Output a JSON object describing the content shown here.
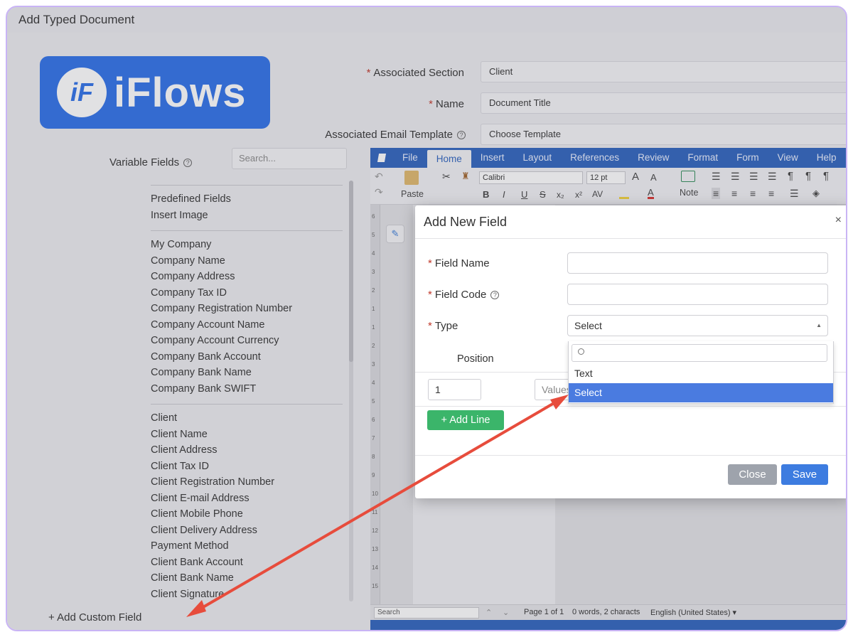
{
  "window": {
    "title": "Add Typed Document"
  },
  "logo": {
    "mark": "iF",
    "text": "iFlows"
  },
  "form": {
    "associated_section_label": "Associated Section",
    "associated_section_value": "Client",
    "name_label": "Name",
    "name_value": "Document Title",
    "email_template_label": "Associated Email Template",
    "email_template_value": "Choose Template",
    "required_mark": "*",
    "help_icon": "?"
  },
  "variable_fields": {
    "label": "Variable Fields",
    "search_placeholder": "Search...",
    "groups": [
      [
        "Predefined Fields",
        "Insert Image"
      ],
      [
        "My Company",
        "Company Name",
        "Company Address",
        "Company Tax ID",
        "Company Registration Number",
        "Company Account Name",
        "Company Account Currency",
        "Company Bank Account",
        "Company Bank Name",
        "Company Bank SWIFT"
      ],
      [
        "Client",
        "Client Name",
        "Client Address",
        "Client Tax ID",
        "Client Registration Number",
        "Client E-mail Address",
        "Client Mobile Phone",
        "Client Delivery Address",
        "Payment Method",
        "Client Bank Account",
        "Client Bank Name",
        "Client Signature"
      ]
    ],
    "add_custom": "+ Add Custom Field"
  },
  "editor": {
    "menu": [
      "File",
      "Home",
      "Insert",
      "Layout",
      "References",
      "Review",
      "Format",
      "Form",
      "View",
      "Help"
    ],
    "active_menu": "Home",
    "paste": "Paste",
    "font": "Calibri",
    "size": "12 pt",
    "note": "Note",
    "format_buttons": [
      "B",
      "I",
      "U",
      "S",
      "x₂",
      "x²"
    ],
    "ruler": [
      "6",
      "5",
      "4",
      "3",
      "2",
      "1",
      "1",
      "2",
      "3",
      "4",
      "5",
      "6",
      "7",
      "8",
      "9",
      "10",
      "11",
      "12",
      "13",
      "14",
      "15"
    ],
    "status": {
      "search_placeholder": "Search",
      "page": "Page 1 of 1",
      "words": "0 words, 2 characts",
      "language": "English (United States) ▾"
    }
  },
  "modal": {
    "title": "Add New Field",
    "close_icon": "×",
    "field_name_label": "Field Name",
    "field_code_label": "Field Code",
    "type_label": "Type",
    "type_value": "Select",
    "position_header": "Position",
    "position_value": "1",
    "values_placeholder": "Values",
    "add_line": "+ Add Line",
    "close_button": "Close",
    "save_button": "Save",
    "dropdown_options": [
      "Text",
      "Select"
    ],
    "dropdown_selected": "Select"
  },
  "colors": {
    "brand": "#2d6fe8",
    "menubar": "#2c62bd",
    "add_line": "#3bb56a",
    "save": "#3d7ce0",
    "arrow": "#e74c3c"
  }
}
